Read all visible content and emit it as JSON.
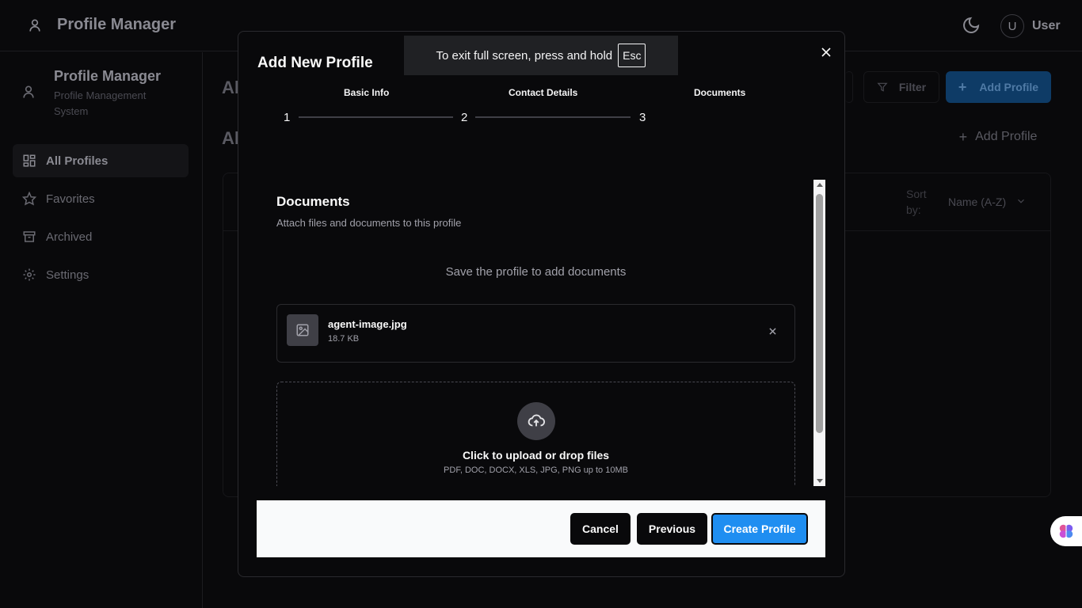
{
  "app": {
    "title": "Profile Manager",
    "user_initial": "U",
    "user_label": "User"
  },
  "sidebar": {
    "brand_title": "Profile Manager",
    "brand_subtitle": "Profile Management System",
    "items": [
      {
        "label": "All Profiles",
        "icon": "grid-icon",
        "active": true
      },
      {
        "label": "Favorites",
        "icon": "star-icon",
        "active": false
      },
      {
        "label": "Archived",
        "icon": "archive-icon",
        "active": false
      },
      {
        "label": "Settings",
        "icon": "gear-icon",
        "active": false
      }
    ]
  },
  "background": {
    "heading_top": "Al",
    "heading_second": "Al",
    "filter_label": "Filter",
    "add_profile_primary": "Add Profile",
    "add_profile_ghost": "Add Profile",
    "sort_label": "Sort by:",
    "sort_value": "Name (A-Z)"
  },
  "modal": {
    "title": "Add New Profile",
    "steps": [
      {
        "label": "Basic Info",
        "number": "1"
      },
      {
        "label": "Contact Details",
        "number": "2"
      },
      {
        "label": "Documents",
        "number": "3"
      }
    ],
    "documents": {
      "title": "Documents",
      "subtitle": "Attach files and documents to this profile",
      "save_note": "Save the profile to add documents",
      "file": {
        "name": "agent-image.jpg",
        "size": "18.7 KB"
      },
      "dropzone_title": "Click to upload or drop files",
      "dropzone_subtitle": "PDF, DOC, DOCX, XLS, JPG, PNG up to 10MB"
    },
    "footer": {
      "cancel": "Cancel",
      "previous": "Previous",
      "create": "Create Profile"
    }
  },
  "fullscreen_toast": {
    "text": "To exit full screen, press and hold",
    "key": "Esc"
  },
  "colors": {
    "primary": "#1f8ef1",
    "background": "#09090b",
    "footer_bg": "#f9fafb"
  }
}
